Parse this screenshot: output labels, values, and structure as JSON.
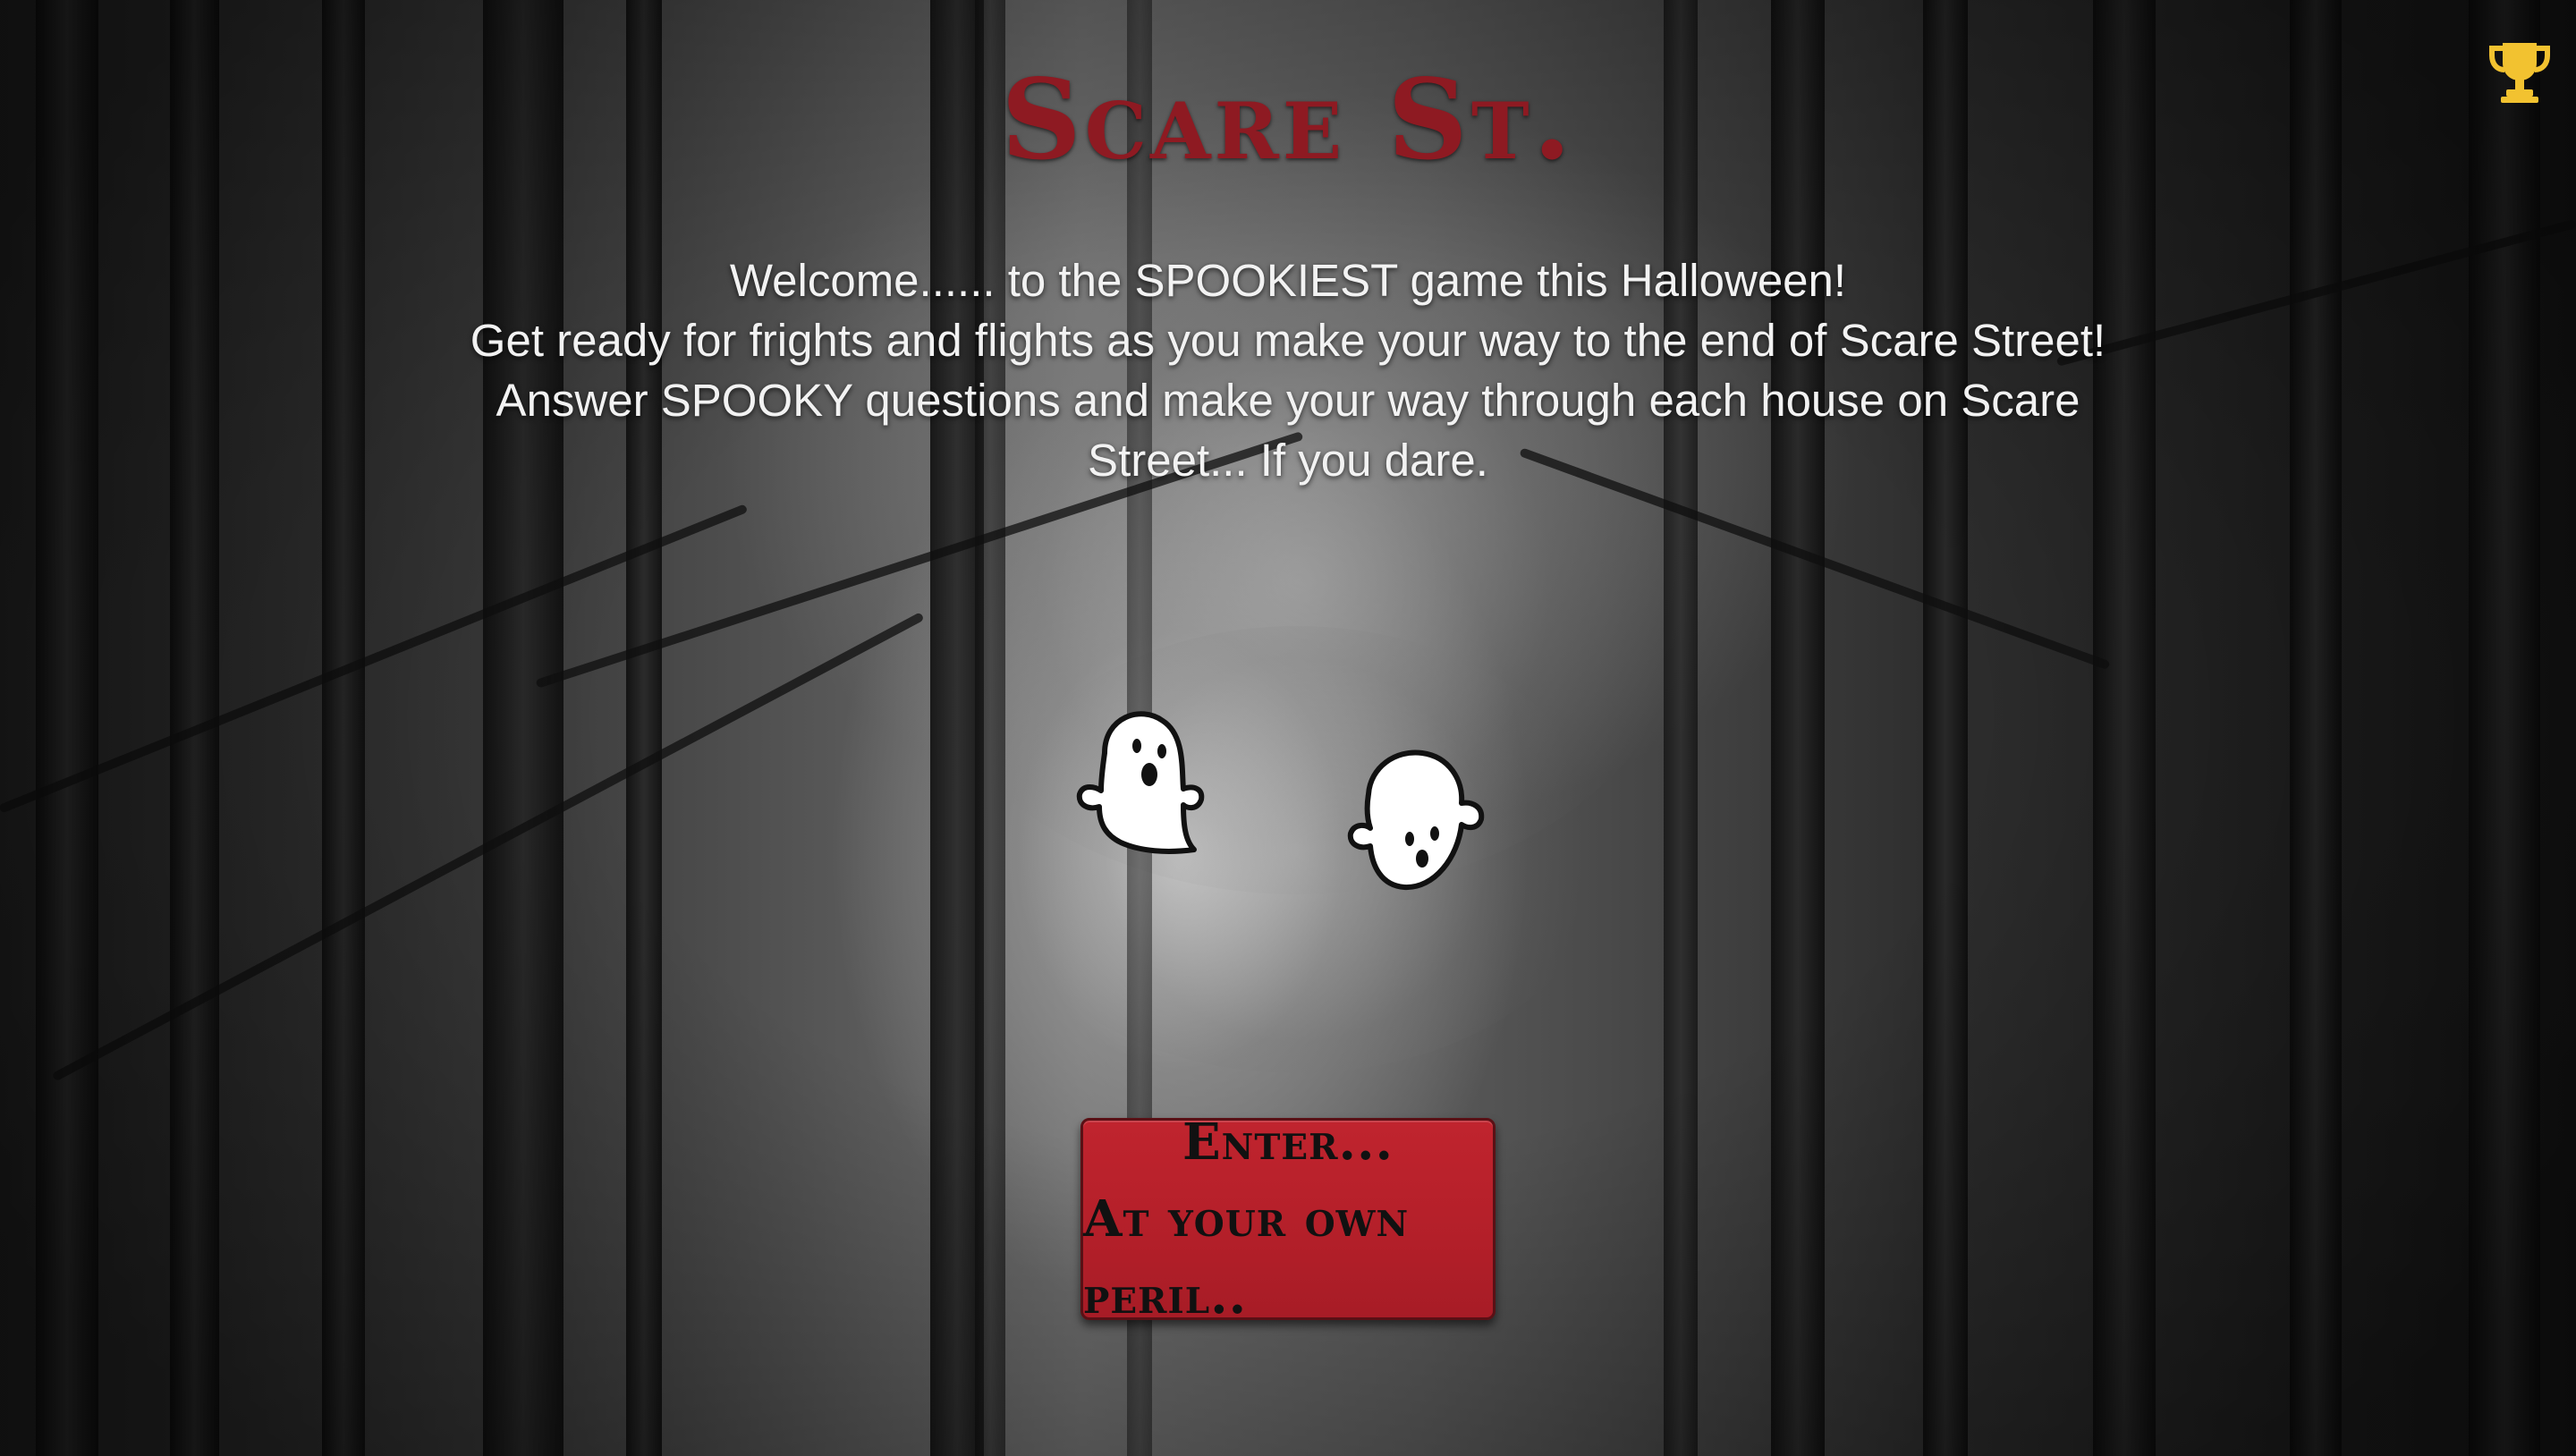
{
  "page": {
    "title": "Scare St.",
    "intro_lines": [
      "Welcome...... to the SPOOKIEST game this Halloween!",
      "Get ready for frights and flights as you make your way to the end of Scare Street! Answer SPOOKY questions and make your way through each house on Scare Street... If you dare."
    ]
  },
  "enter_button": {
    "line1": "Enter...",
    "line2": "At your own peril.."
  },
  "icons": {
    "trophy": "trophy-icon",
    "ghost_left": "ghost-icon",
    "ghost_right": "ghost-icon"
  },
  "colors": {
    "title": "#8e1a22",
    "button_bg": "#b31f29",
    "button_text": "#111111",
    "intro_text": "#f2f2f2",
    "trophy": "#f2c230"
  }
}
